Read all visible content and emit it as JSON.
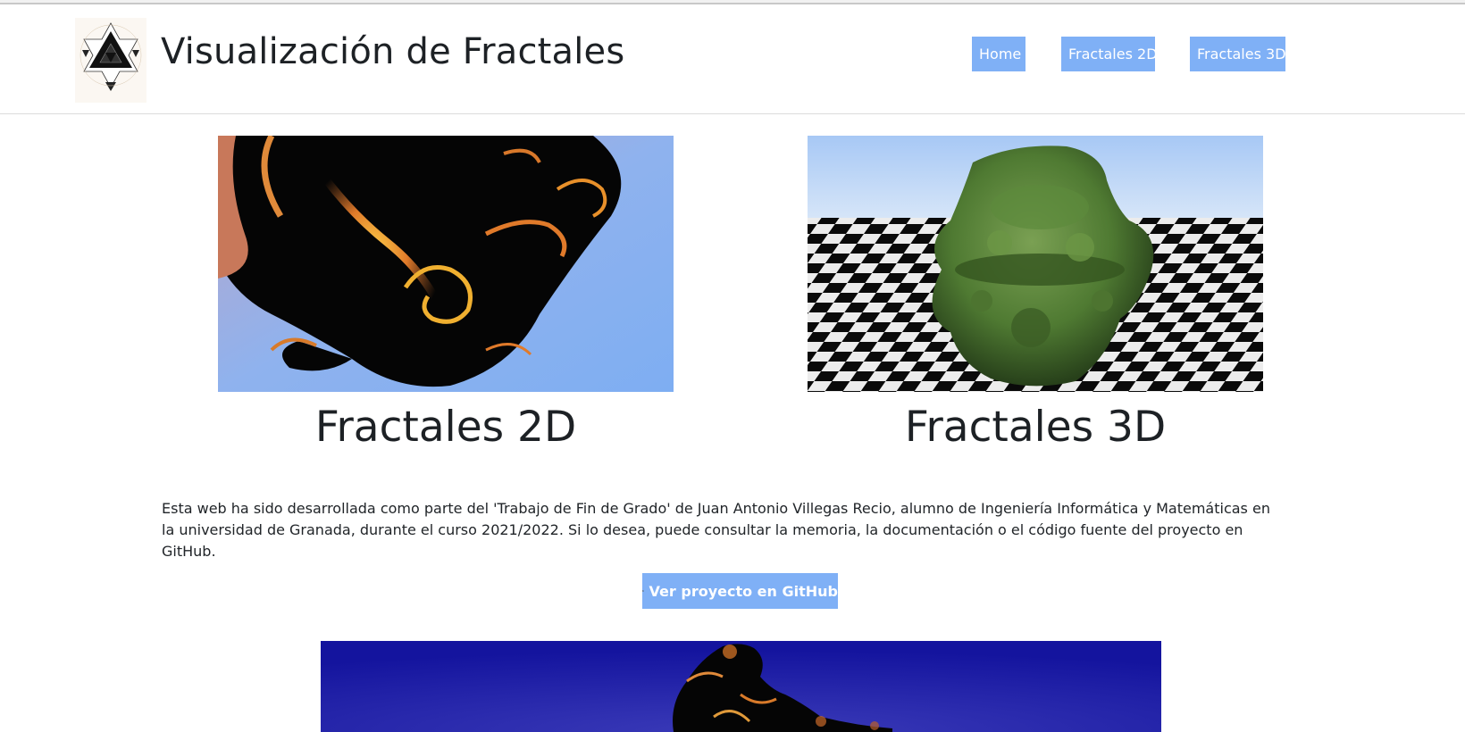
{
  "header": {
    "logo_icon": "sierpinski-koch-fractal-icon",
    "title": "Visualización de Fractales"
  },
  "nav": {
    "home": "Home",
    "fractales_2d": "Fractales 2D",
    "fractales_3d": "Fractales 3D"
  },
  "cards": [
    {
      "title": "Fractales 2D",
      "image": "julia-set-spiral-image"
    },
    {
      "title": "Fractales 3D",
      "image": "mandelbulb-on-checkerboard-image"
    }
  ],
  "intro": {
    "text": "Esta web ha sido desarrollada como parte del 'Trabajo de Fin de Grado' de Juan Antonio Villegas Recio, alumno de Ingeniería Informática y Matemáticas en la universidad de Granada, durante el curso 2021/2022. Si lo desea, puede consultar la memoria, la documentación o el código fuente del proyecto en GitHub."
  },
  "github_button": {
    "icon": "github-icon",
    "label": "Ver proyecto en GitHub"
  },
  "bottom_image": "mandelbrot-fractal-image",
  "colors": {
    "accent": "#7fb0f6",
    "text": "#212529"
  }
}
